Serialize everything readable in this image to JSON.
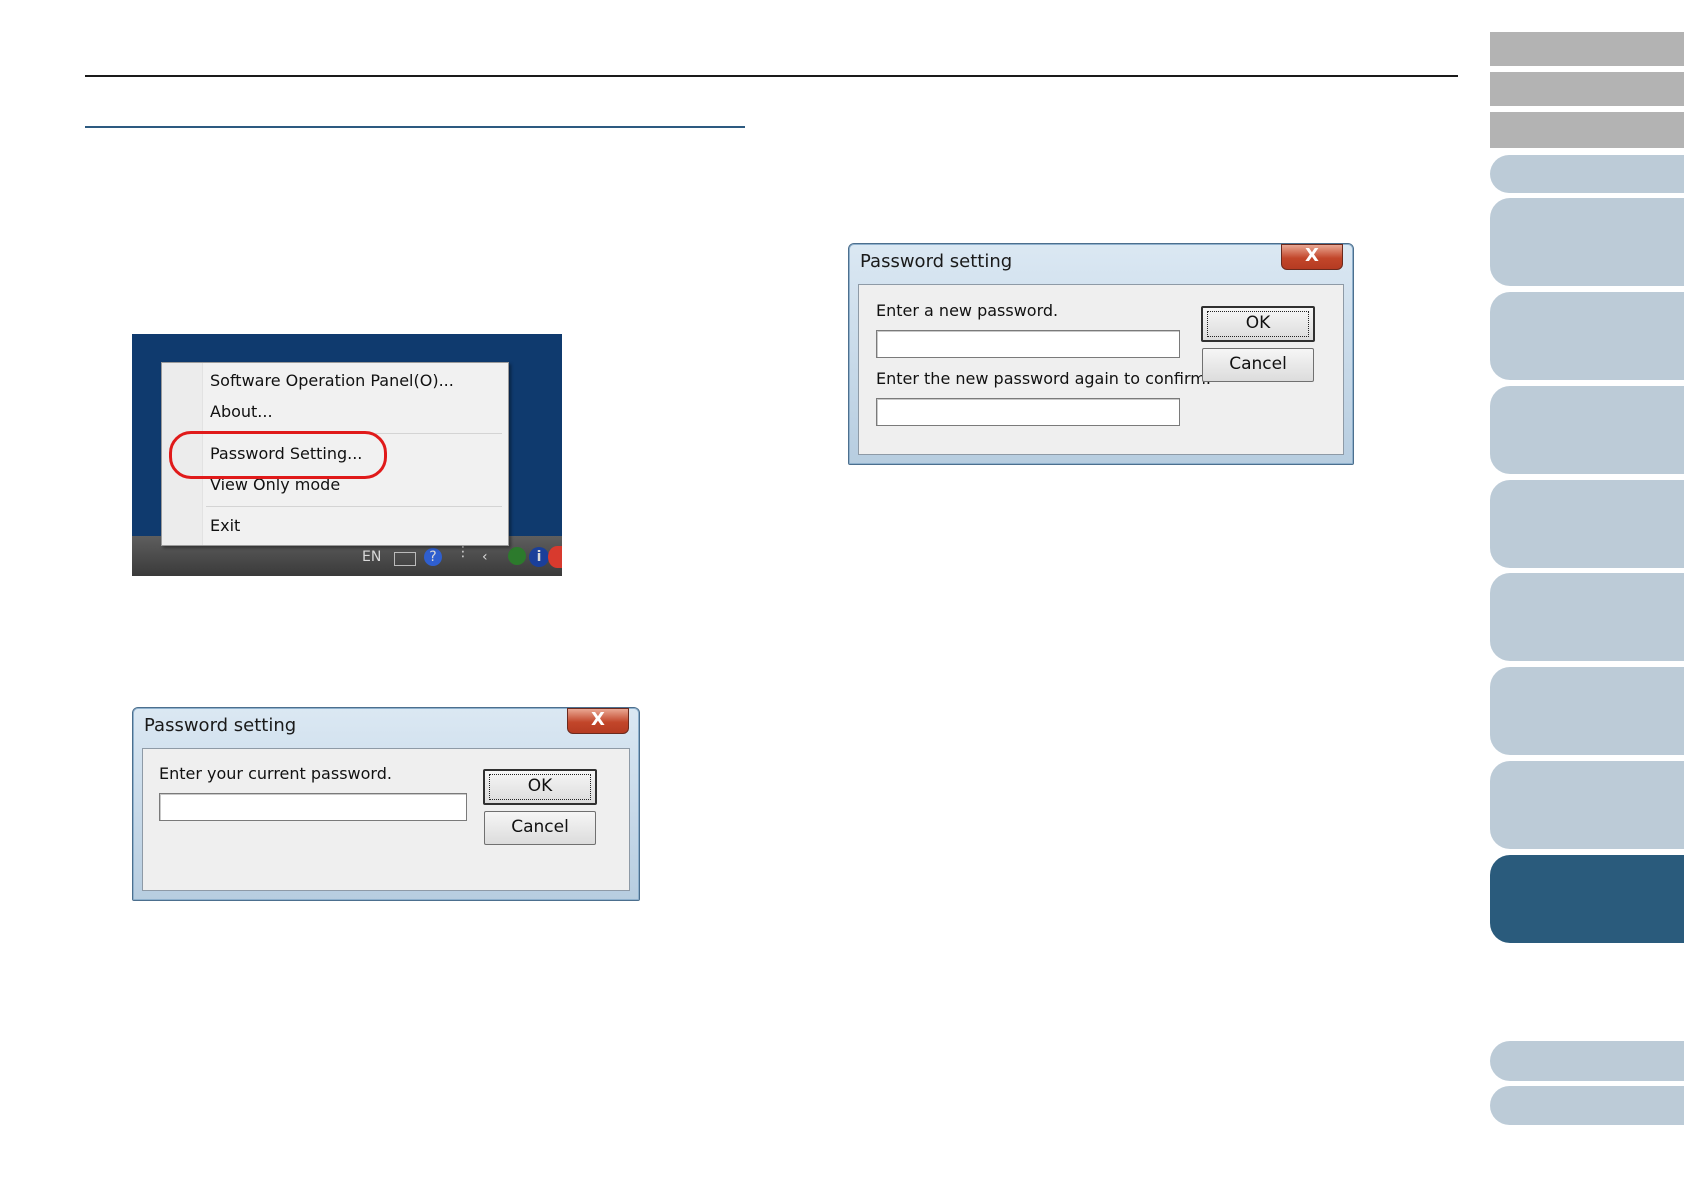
{
  "tray_menu": {
    "items": [
      "Software Operation Panel(O)...",
      "About...",
      "Password Setting...",
      "View Only mode",
      "Exit"
    ],
    "highlighted_item": "Password Setting...",
    "taskbar_lang": "EN",
    "taskbar_help_glyph": "?",
    "taskbar_info_glyph": "i",
    "highlight_color": "#e01a1a"
  },
  "dialog_current": {
    "title": "Password setting",
    "close_glyph": "X",
    "label": "Enter your current password.",
    "ok_label": "OK",
    "cancel_label": "Cancel"
  },
  "dialog_new": {
    "title": "Password setting",
    "close_glyph": "X",
    "label_new": "Enter a new password.",
    "label_confirm": "Enter the new password again to confirm.",
    "ok_label": "OK",
    "cancel_label": "Cancel"
  },
  "colors": {
    "tab_active": "#2a5b7c",
    "tab_inactive": "#bccbd7",
    "tab_gray": "#b3b3b3",
    "section_rule": "#2d5a80"
  }
}
